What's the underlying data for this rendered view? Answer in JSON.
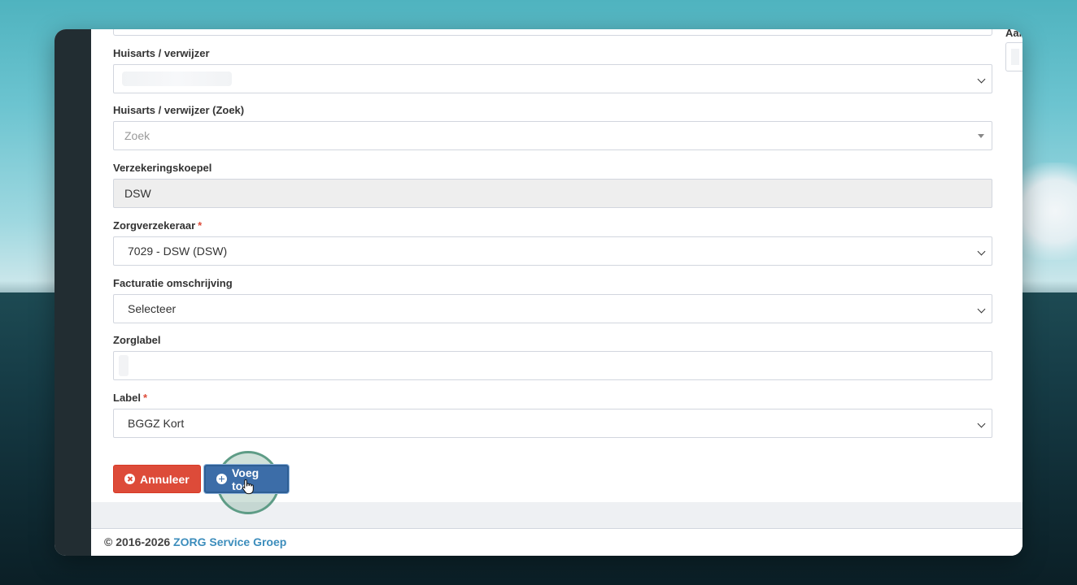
{
  "right_panel": {
    "label": "Aan"
  },
  "form": {
    "huisarts": {
      "label": "Huisarts / verwijzer",
      "value": ""
    },
    "huisarts_zoek": {
      "label": "Huisarts / verwijzer (Zoek)",
      "placeholder": "Zoek"
    },
    "verzekeringskoepel": {
      "label": "Verzekeringskoepel",
      "value": "DSW"
    },
    "zorgverzekeraar": {
      "label": "Zorgverzekeraar",
      "required_mark": "*",
      "value": "7029 - DSW (DSW)"
    },
    "facturatie": {
      "label": "Facturatie omschrijving",
      "value": "Selecteer"
    },
    "zorglabel": {
      "label": "Zorglabel",
      "value": ""
    },
    "label_field": {
      "label": "Label",
      "required_mark": "*",
      "value": "BGGZ Kort"
    }
  },
  "buttons": {
    "cancel": "Annuleer",
    "add": "Voeg toe"
  },
  "footer": {
    "copyright": "© 2016-2026 ",
    "brand": "ZORG Service Groep"
  },
  "icons": {
    "cancel": "times-circle-icon",
    "add": "plus-circle-icon",
    "select": "chevron-down-icon",
    "search_select": "caret-down-icon",
    "cursor": "hand-pointer-icon"
  },
  "colors": {
    "sidebar": "#222d32",
    "danger": "#dd4b39",
    "primary": "#3c6da8",
    "brand_link": "#3c8dbc",
    "required": "#dd4b39"
  }
}
